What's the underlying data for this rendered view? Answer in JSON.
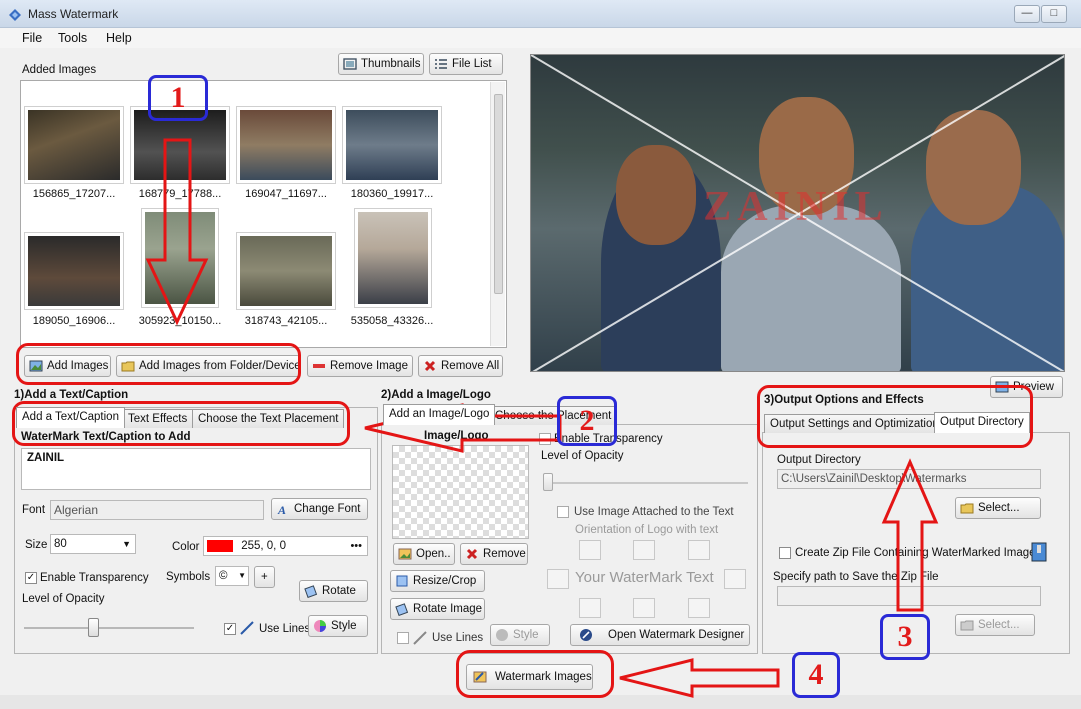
{
  "window": {
    "title": "Mass Watermark",
    "minimize_label": "—",
    "maximize_label": "□",
    "close_label": "✕"
  },
  "menu": {
    "file": "File",
    "tools": "Tools",
    "help": "Help"
  },
  "images": {
    "header": "Added Images",
    "view_thumbnails": "Thumbnails",
    "view_file_list": "File List",
    "thumbnails": [
      "156865_17207...",
      "168779_17788...",
      "169047_11697...",
      "180360_19917...",
      "189050_16906...",
      "305923_10150...",
      "318743_42105...",
      "535058_43326..."
    ],
    "add_images": "Add Images",
    "add_from_folder": "Add Images from Folder/Device",
    "remove_image": "Remove Image",
    "remove_all": "Remove All"
  },
  "preview": {
    "watermark_text": "ZAINIL",
    "preview_button": "Preview"
  },
  "text_section": {
    "heading": "1)Add a Text/Caption",
    "tabs": [
      "Add a Text/Caption",
      "Text Effects",
      "Choose the Text Placement"
    ],
    "caption_label": "WaterMark Text/Caption to Add",
    "caption_value": "ZAINIL",
    "font_label": "Font",
    "font_value": "Algerian",
    "change_font": "Change Font",
    "size_label": "Size",
    "size_value": "80",
    "color_label": "Color",
    "color_value": "255, 0, 0",
    "color_swatch": "#ff0000",
    "enable_transparency": "Enable Transparency",
    "symbols_label": "Symbols",
    "symbol_value": "©",
    "plus_label": "+",
    "rotate": "Rotate",
    "opacity_label": "Level of Opacity",
    "use_lines": "Use Lines",
    "style": "Style"
  },
  "logo_section": {
    "heading": "2)Add a Image/Logo",
    "tabs": [
      "Add an Image/Logo",
      "Choose the Placement"
    ],
    "image_label": "Image/Logo",
    "enable_transparency": "Enable Transparency",
    "opacity_label": "Level of Opacity",
    "use_attached": "Use Image Attached to the Text",
    "orientation_label": "Orientation of Logo with text",
    "your_watermark": "Your WaterMark Text",
    "open": "Open..",
    "remove": "Remove",
    "resize_crop": "Resize/Crop",
    "rotate_image": "Rotate Image",
    "use_lines": "Use Lines",
    "style": "Style",
    "open_designer": "Open Watermark Designer"
  },
  "output_section": {
    "heading": "3)Output Options and Effects",
    "tabs": [
      "Output Settings and Optimization",
      "Output Directory"
    ],
    "dir_label": "Output Directory",
    "dir_value": "C:\\Users\\Zainil\\Desktop\\Watermarks",
    "select": "Select...",
    "zip_label": "Create Zip File Containing WaterMarked Images",
    "zip_path_label": "Specify path to Save the Zip File",
    "zip_path_value": "",
    "select2": "Select..."
  },
  "watermark_button": "Watermark Images",
  "annotations": {
    "n1": "1",
    "n2": "2",
    "n3": "3",
    "n4": "4"
  },
  "colors": {
    "annotation_red": "#e41515",
    "annotation_blue": "#2a2ad6"
  }
}
